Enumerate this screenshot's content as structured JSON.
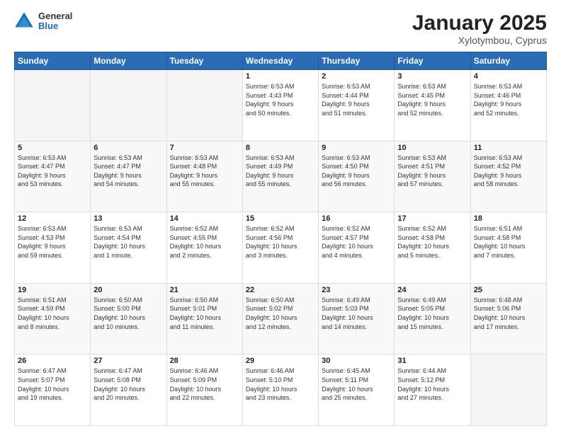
{
  "header": {
    "logo_general": "General",
    "logo_blue": "Blue",
    "month_title": "January 2025",
    "subtitle": "Xylotymbou, Cyprus"
  },
  "weekdays": [
    "Sunday",
    "Monday",
    "Tuesday",
    "Wednesday",
    "Thursday",
    "Friday",
    "Saturday"
  ],
  "weeks": [
    [
      {
        "day": "",
        "info": ""
      },
      {
        "day": "",
        "info": ""
      },
      {
        "day": "",
        "info": ""
      },
      {
        "day": "1",
        "info": "Sunrise: 6:53 AM\nSunset: 4:43 PM\nDaylight: 9 hours\nand 50 minutes."
      },
      {
        "day": "2",
        "info": "Sunrise: 6:53 AM\nSunset: 4:44 PM\nDaylight: 9 hours\nand 51 minutes."
      },
      {
        "day": "3",
        "info": "Sunrise: 6:53 AM\nSunset: 4:45 PM\nDaylight: 9 hours\nand 52 minutes."
      },
      {
        "day": "4",
        "info": "Sunrise: 6:53 AM\nSunset: 4:46 PM\nDaylight: 9 hours\nand 52 minutes."
      }
    ],
    [
      {
        "day": "5",
        "info": "Sunrise: 6:53 AM\nSunset: 4:47 PM\nDaylight: 9 hours\nand 53 minutes."
      },
      {
        "day": "6",
        "info": "Sunrise: 6:53 AM\nSunset: 4:47 PM\nDaylight: 9 hours\nand 54 minutes."
      },
      {
        "day": "7",
        "info": "Sunrise: 6:53 AM\nSunset: 4:48 PM\nDaylight: 9 hours\nand 55 minutes."
      },
      {
        "day": "8",
        "info": "Sunrise: 6:53 AM\nSunset: 4:49 PM\nDaylight: 9 hours\nand 55 minutes."
      },
      {
        "day": "9",
        "info": "Sunrise: 6:53 AM\nSunset: 4:50 PM\nDaylight: 9 hours\nand 56 minutes."
      },
      {
        "day": "10",
        "info": "Sunrise: 6:53 AM\nSunset: 4:51 PM\nDaylight: 9 hours\nand 57 minutes."
      },
      {
        "day": "11",
        "info": "Sunrise: 6:53 AM\nSunset: 4:52 PM\nDaylight: 9 hours\nand 58 minutes."
      }
    ],
    [
      {
        "day": "12",
        "info": "Sunrise: 6:53 AM\nSunset: 4:53 PM\nDaylight: 9 hours\nand 59 minutes."
      },
      {
        "day": "13",
        "info": "Sunrise: 6:53 AM\nSunset: 4:54 PM\nDaylight: 10 hours\nand 1 minute."
      },
      {
        "day": "14",
        "info": "Sunrise: 6:52 AM\nSunset: 4:55 PM\nDaylight: 10 hours\nand 2 minutes."
      },
      {
        "day": "15",
        "info": "Sunrise: 6:52 AM\nSunset: 4:56 PM\nDaylight: 10 hours\nand 3 minutes."
      },
      {
        "day": "16",
        "info": "Sunrise: 6:52 AM\nSunset: 4:57 PM\nDaylight: 10 hours\nand 4 minutes."
      },
      {
        "day": "17",
        "info": "Sunrise: 6:52 AM\nSunset: 4:58 PM\nDaylight: 10 hours\nand 5 minutes."
      },
      {
        "day": "18",
        "info": "Sunrise: 6:51 AM\nSunset: 4:58 PM\nDaylight: 10 hours\nand 7 minutes."
      }
    ],
    [
      {
        "day": "19",
        "info": "Sunrise: 6:51 AM\nSunset: 4:59 PM\nDaylight: 10 hours\nand 8 minutes."
      },
      {
        "day": "20",
        "info": "Sunrise: 6:50 AM\nSunset: 5:00 PM\nDaylight: 10 hours\nand 10 minutes."
      },
      {
        "day": "21",
        "info": "Sunrise: 6:50 AM\nSunset: 5:01 PM\nDaylight: 10 hours\nand 11 minutes."
      },
      {
        "day": "22",
        "info": "Sunrise: 6:50 AM\nSunset: 5:02 PM\nDaylight: 10 hours\nand 12 minutes."
      },
      {
        "day": "23",
        "info": "Sunrise: 6:49 AM\nSunset: 5:03 PM\nDaylight: 10 hours\nand 14 minutes."
      },
      {
        "day": "24",
        "info": "Sunrise: 6:49 AM\nSunset: 5:05 PM\nDaylight: 10 hours\nand 15 minutes."
      },
      {
        "day": "25",
        "info": "Sunrise: 6:48 AM\nSunset: 5:06 PM\nDaylight: 10 hours\nand 17 minutes."
      }
    ],
    [
      {
        "day": "26",
        "info": "Sunrise: 6:47 AM\nSunset: 5:07 PM\nDaylight: 10 hours\nand 19 minutes."
      },
      {
        "day": "27",
        "info": "Sunrise: 6:47 AM\nSunset: 5:08 PM\nDaylight: 10 hours\nand 20 minutes."
      },
      {
        "day": "28",
        "info": "Sunrise: 6:46 AM\nSunset: 5:09 PM\nDaylight: 10 hours\nand 22 minutes."
      },
      {
        "day": "29",
        "info": "Sunrise: 6:46 AM\nSunset: 5:10 PM\nDaylight: 10 hours\nand 23 minutes."
      },
      {
        "day": "30",
        "info": "Sunrise: 6:45 AM\nSunset: 5:11 PM\nDaylight: 10 hours\nand 25 minutes."
      },
      {
        "day": "31",
        "info": "Sunrise: 6:44 AM\nSunset: 5:12 PM\nDaylight: 10 hours\nand 27 minutes."
      },
      {
        "day": "",
        "info": ""
      }
    ]
  ]
}
